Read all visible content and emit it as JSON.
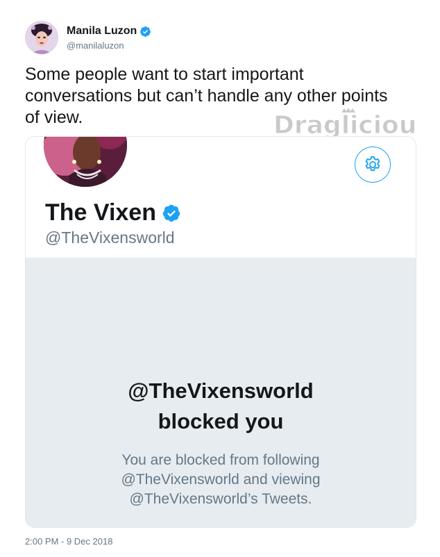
{
  "tweet": {
    "author_name": "Manila Luzon",
    "author_handle": "@manilaluzon",
    "text": "Some people want to start important conversations but can’t handle any other points of view.",
    "timestamp": "2:00 PM - 9 Dec 2018"
  },
  "watermark": {
    "text": "Draglicious"
  },
  "card": {
    "profile_name": "The Vixen",
    "profile_handle": "@TheVixensworld",
    "blocked_title_line1": "@TheVixensworld",
    "blocked_title_line2": "blocked you",
    "blocked_desc_line1": "You are blocked from following",
    "blocked_desc_line2": "@TheVixensworld and viewing",
    "blocked_desc_line3": "@TheVixensworld’s Tweets."
  },
  "icons": {
    "verified": "verified-badge-icon",
    "settings": "gear-icon"
  },
  "colors": {
    "twitter_blue": "#1da1f2",
    "secondary_text": "#657786",
    "panel_bg": "#e6ecf0",
    "border": "#e1e8ed"
  }
}
